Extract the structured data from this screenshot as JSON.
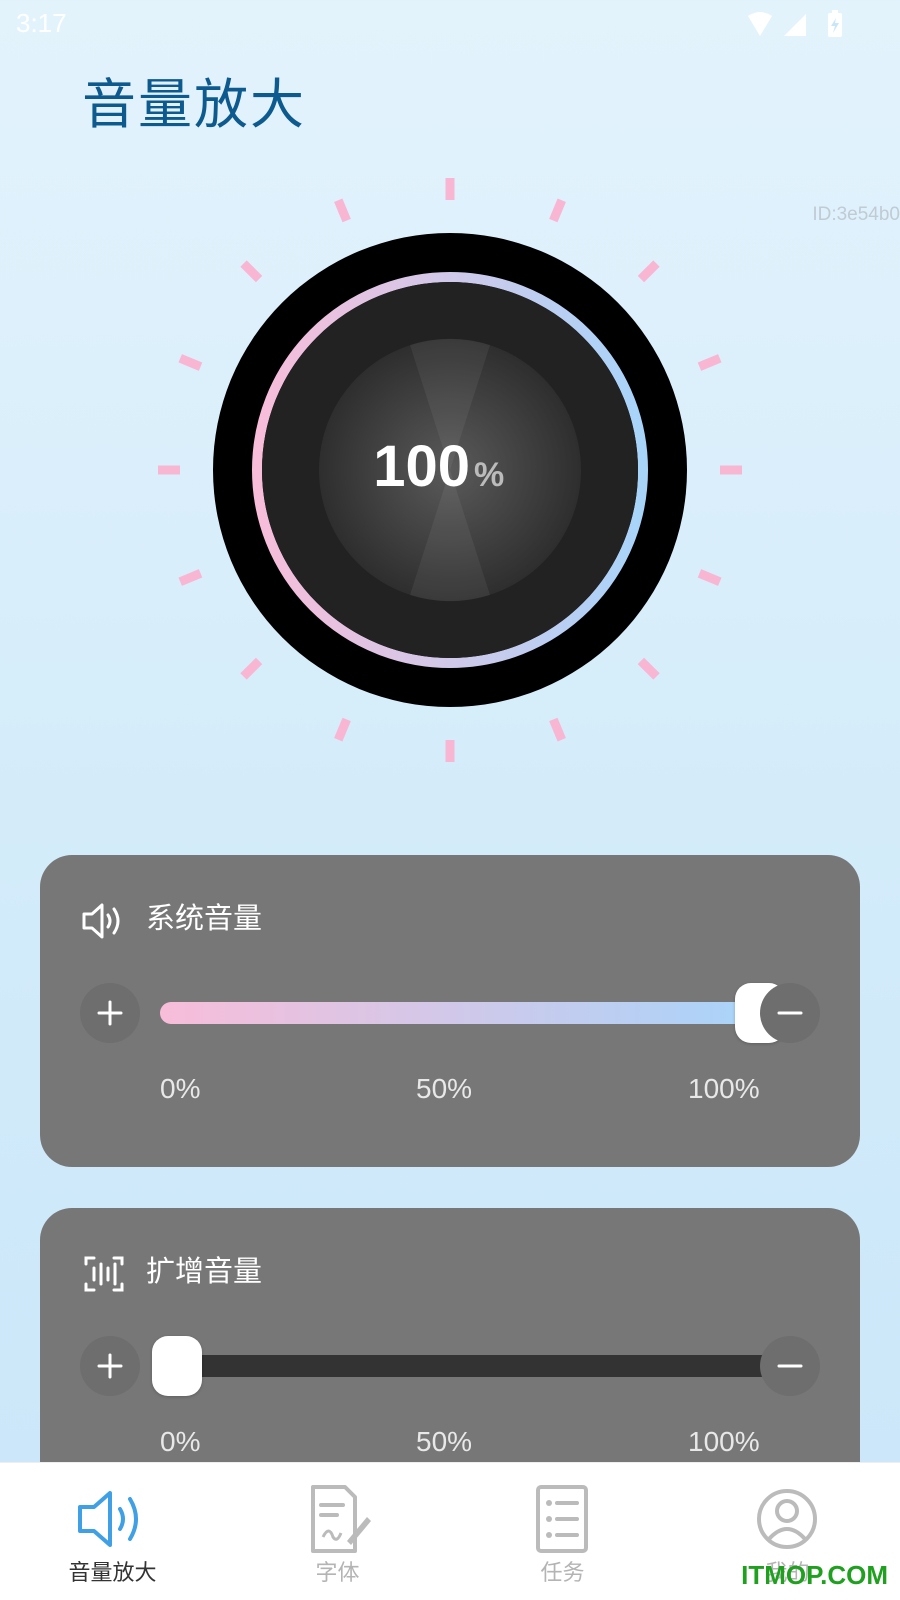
{
  "status_bar": {
    "time": "3:17"
  },
  "header": {
    "title": "音量放大",
    "id_text": "ID:3e54b0"
  },
  "dial": {
    "value": "100",
    "unit": "%"
  },
  "cards": {
    "system": {
      "title": "系统音量",
      "value_fraction": 1.0,
      "plus_icon": "plus-icon",
      "minus_icon": "minus-icon",
      "ticks": [
        "0%",
        "50%",
        "100%"
      ]
    },
    "expand": {
      "title": "扩增音量",
      "value_fraction": 0.0,
      "ticks": [
        "0%",
        "50%",
        "100%"
      ]
    }
  },
  "nav": {
    "items": [
      {
        "label": "音量放大",
        "icon": "speaker-icon",
        "active": true
      },
      {
        "label": "字体",
        "icon": "document-pen-icon",
        "active": false
      },
      {
        "label": "任务",
        "icon": "task-list-icon",
        "active": false
      },
      {
        "label": "我的",
        "icon": "profile-icon",
        "active": false
      }
    ]
  },
  "watermark": "ITMOP.COM",
  "colors": {
    "title": "#0c5a8e",
    "gradient_start": "#f8bdd9",
    "gradient_end": "#a8d4fa",
    "tick_marks": "#f9b6d3",
    "nav_active": "#3fa0e6",
    "nav_inactive": "#bbbbbb"
  }
}
